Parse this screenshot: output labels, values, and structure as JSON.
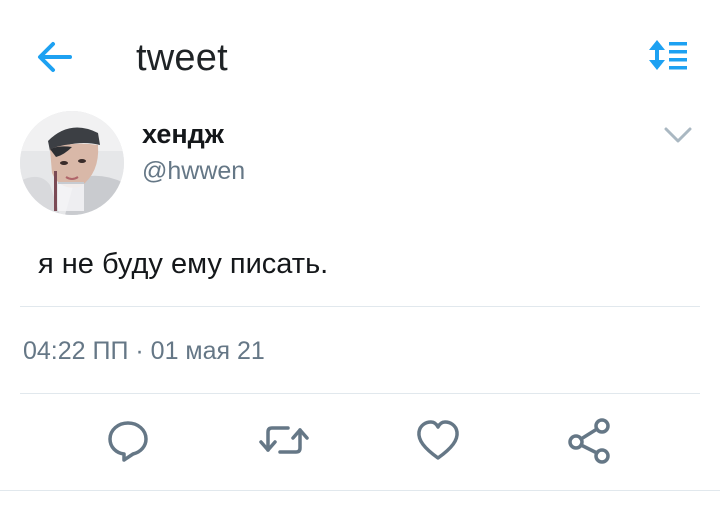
{
  "header": {
    "back_icon": "arrow-left-icon",
    "title": "tweet",
    "sort_icon": "sort-order-icon",
    "accent_color": "#1da1f2"
  },
  "tweet": {
    "display_name": "хендж",
    "username": "@hwwen",
    "avatar": "profile-photo",
    "menu_icon": "chevron-down-icon",
    "text": "я не буду ему писать.",
    "timestamp": "04:22 ПП · 01 мая 21"
  },
  "actions": [
    {
      "icon": "reply-icon"
    },
    {
      "icon": "retweet-icon"
    },
    {
      "icon": "like-icon"
    },
    {
      "icon": "share-icon"
    }
  ]
}
